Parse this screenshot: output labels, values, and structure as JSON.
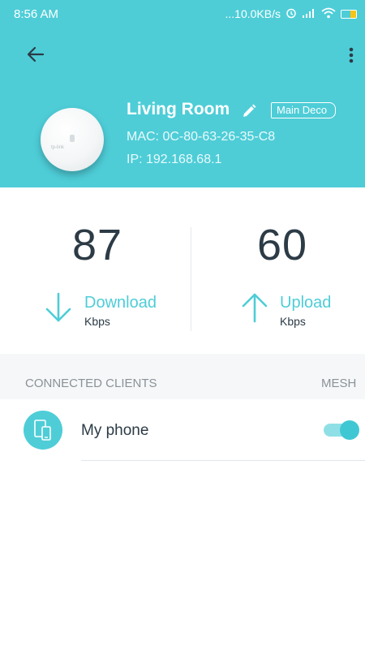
{
  "status_bar": {
    "time": "8:56 AM",
    "network_speed": "...10.0KB/s",
    "icons": [
      "alarm-icon",
      "signal-icon",
      "wifi-icon",
      "battery-icon"
    ]
  },
  "header": {
    "background_color": "#4ecdd7",
    "back_icon": "arrow-left-icon",
    "more_icon": "more-vertical-icon",
    "device": {
      "name": "Living Room",
      "role_badge": "Main Deco",
      "mac": "MAC: 0C-80-63-26-35-C8",
      "ip": "IP: 192.168.68.1",
      "logo_text": "tp-link"
    }
  },
  "stats": {
    "download": {
      "value": "87",
      "label": "Download",
      "unit": "Kbps",
      "icon": "arrow-down-icon"
    },
    "upload": {
      "value": "60",
      "label": "Upload",
      "unit": "Kbps",
      "icon": "arrow-up-icon"
    }
  },
  "clients": {
    "section_title": "CONNECTED CLIENTS",
    "mesh_title": "MESH",
    "items": [
      {
        "name": "My phone",
        "icon": "device-icon",
        "mesh_enabled": true
      }
    ]
  },
  "colors": {
    "accent": "#4ecdd7",
    "text_dark": "#2c3b46",
    "text_muted": "#8a9298"
  }
}
